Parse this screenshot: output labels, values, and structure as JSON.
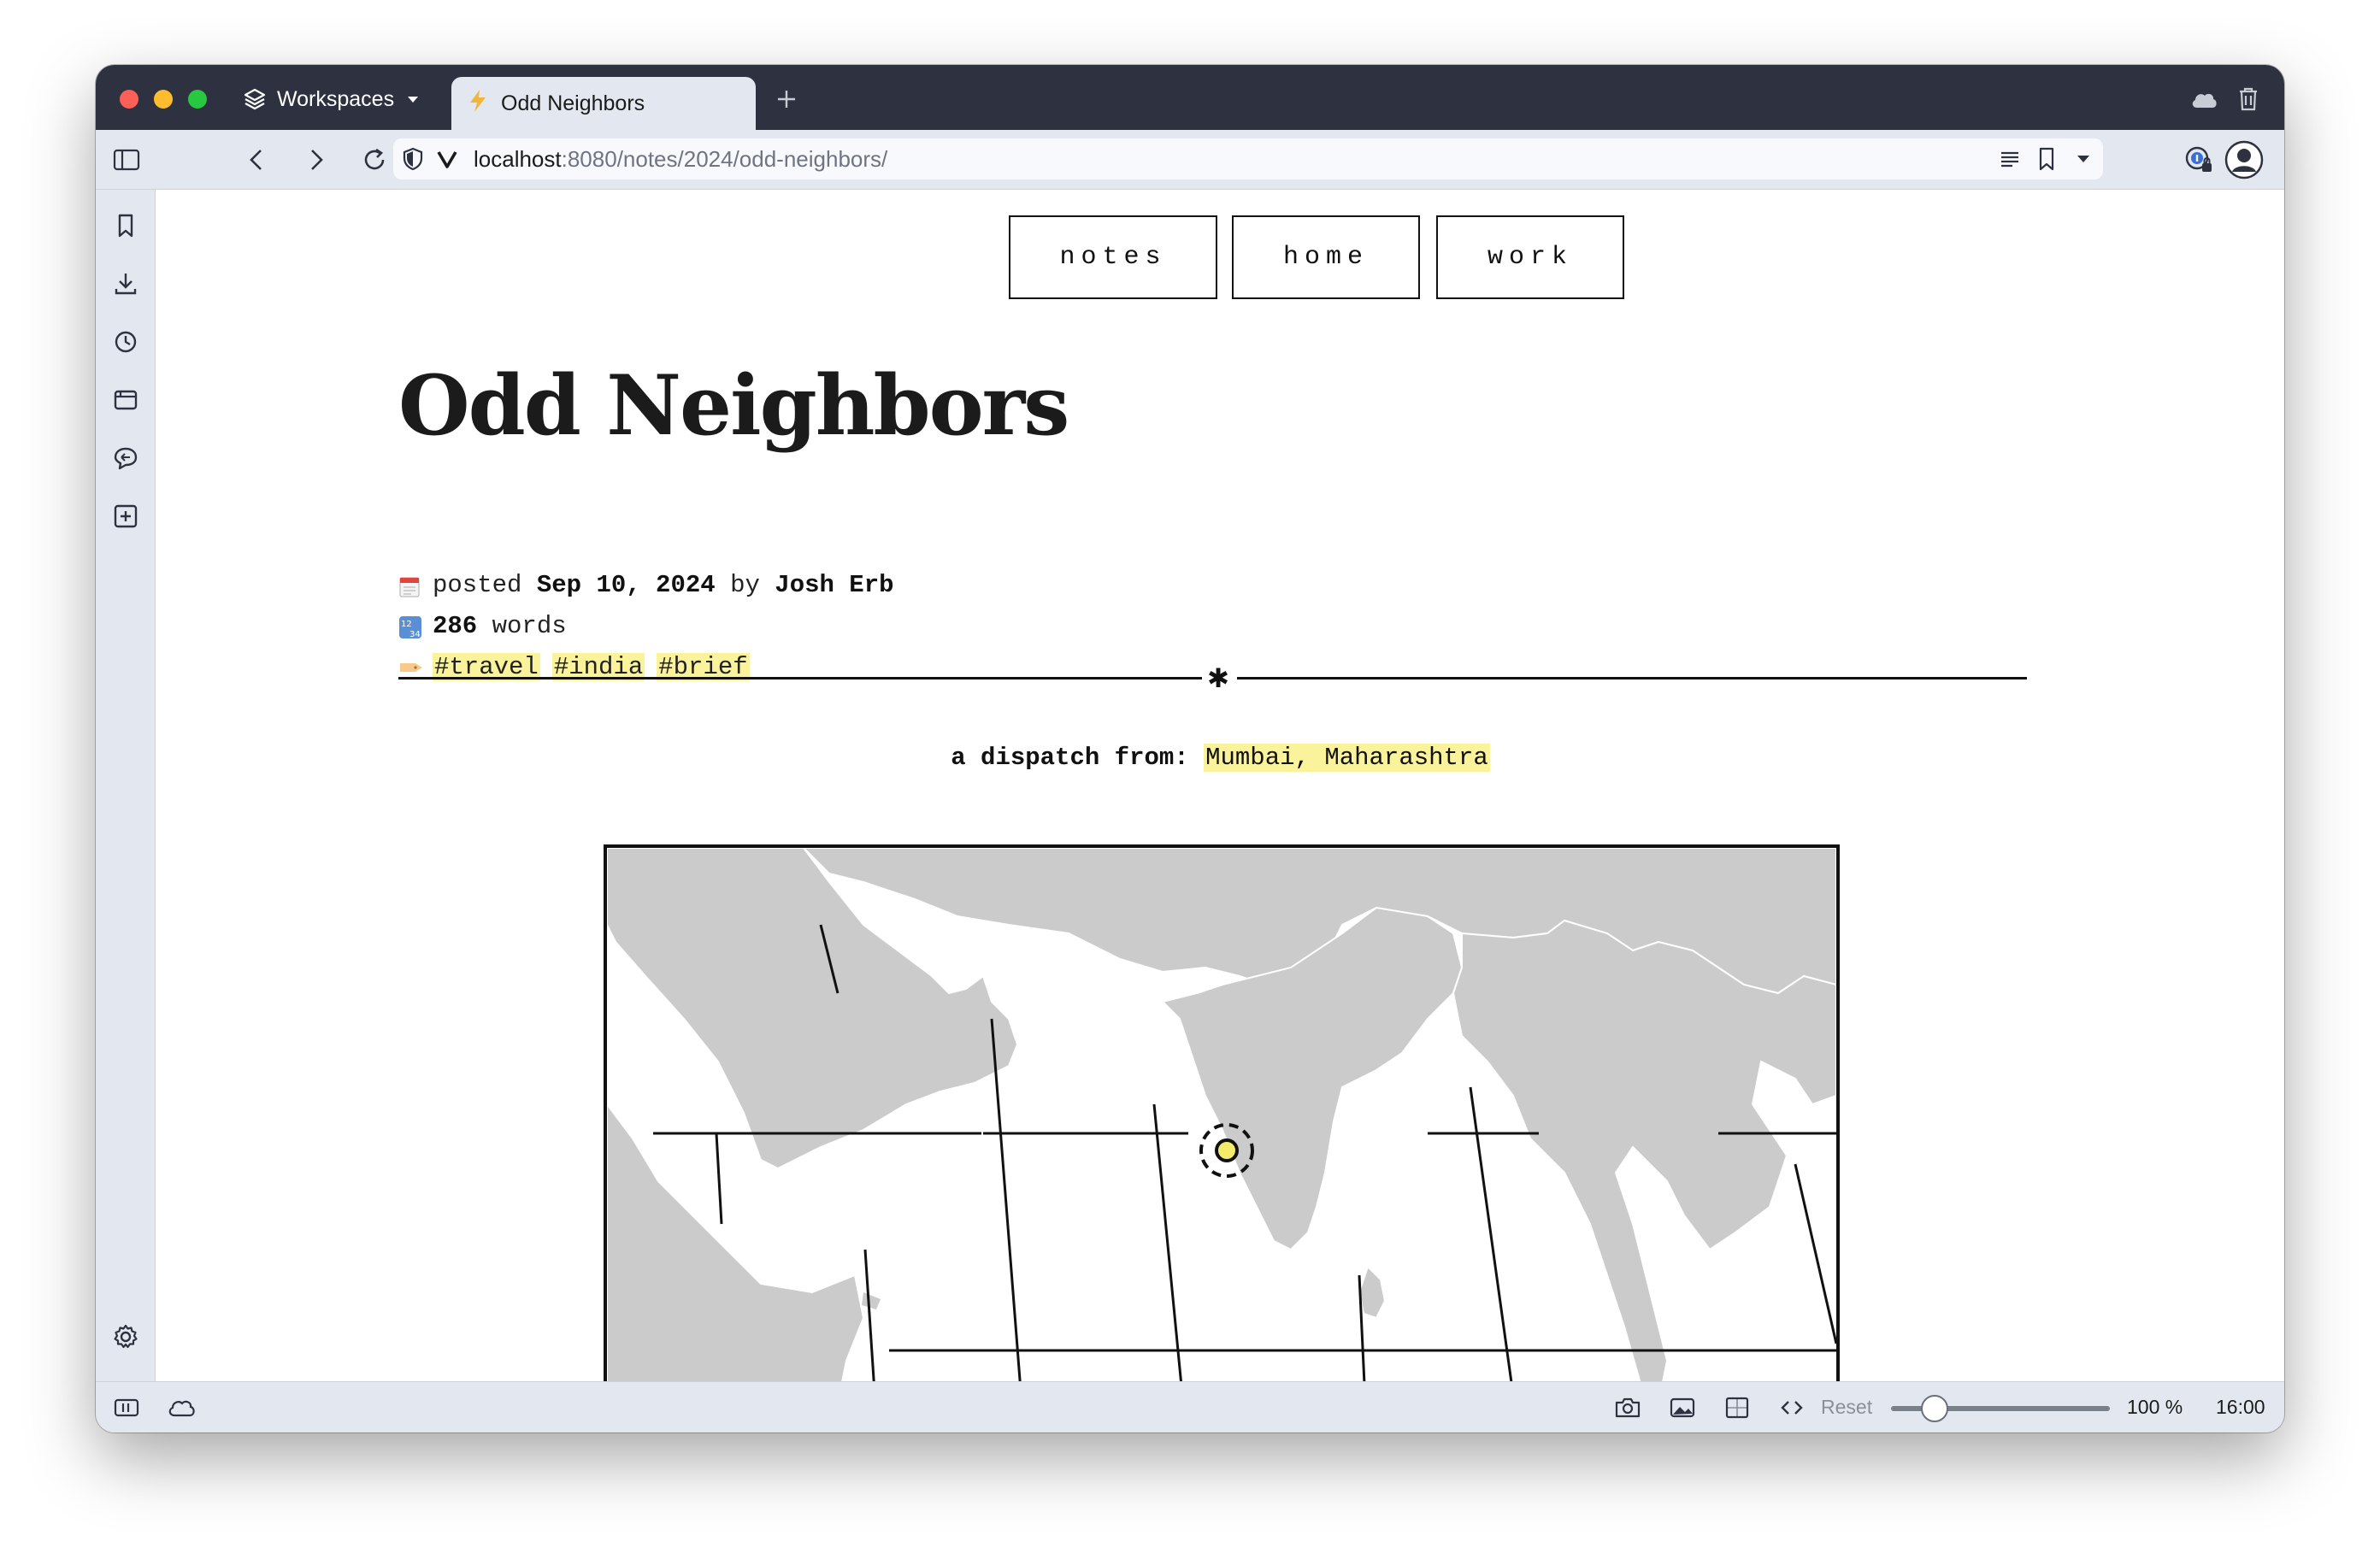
{
  "browser": {
    "workspaces_label": "Workspaces",
    "active_tab_title": "Odd Neighbors",
    "url_host": "localhost",
    "url_path": ":8080/notes/2024/odd-neighbors/"
  },
  "status": {
    "reset_label": "Reset",
    "zoom_label": "100 %",
    "zoom_level": 0.2,
    "time": "16:00"
  },
  "nav": {
    "items": [
      {
        "label": "notes"
      },
      {
        "label": "home"
      },
      {
        "label": "work"
      }
    ]
  },
  "post": {
    "title": "Odd Neighbors",
    "posted_prefix": "posted",
    "date": "Sep 10, 2024",
    "by_word": "by",
    "author": "Josh Erb",
    "word_count": "286",
    "words_label": "words",
    "tags": [
      "#travel",
      "#india",
      "#brief"
    ],
    "divider_symbol": "✱",
    "dispatch_label": "a dispatch from:",
    "dispatch_location": "Mumbai, Maharashtra"
  },
  "colors": {
    "tab_bar": "#2e3240",
    "chrome": "#e3e8f0",
    "tag_highlight": "#faf39b",
    "land": "#cbcbcb",
    "marker_fill": "#f5ec6c"
  },
  "icons": {
    "calendar": "calendar-icon",
    "numbers": "numbers-icon",
    "tag": "label-tag-icon"
  }
}
